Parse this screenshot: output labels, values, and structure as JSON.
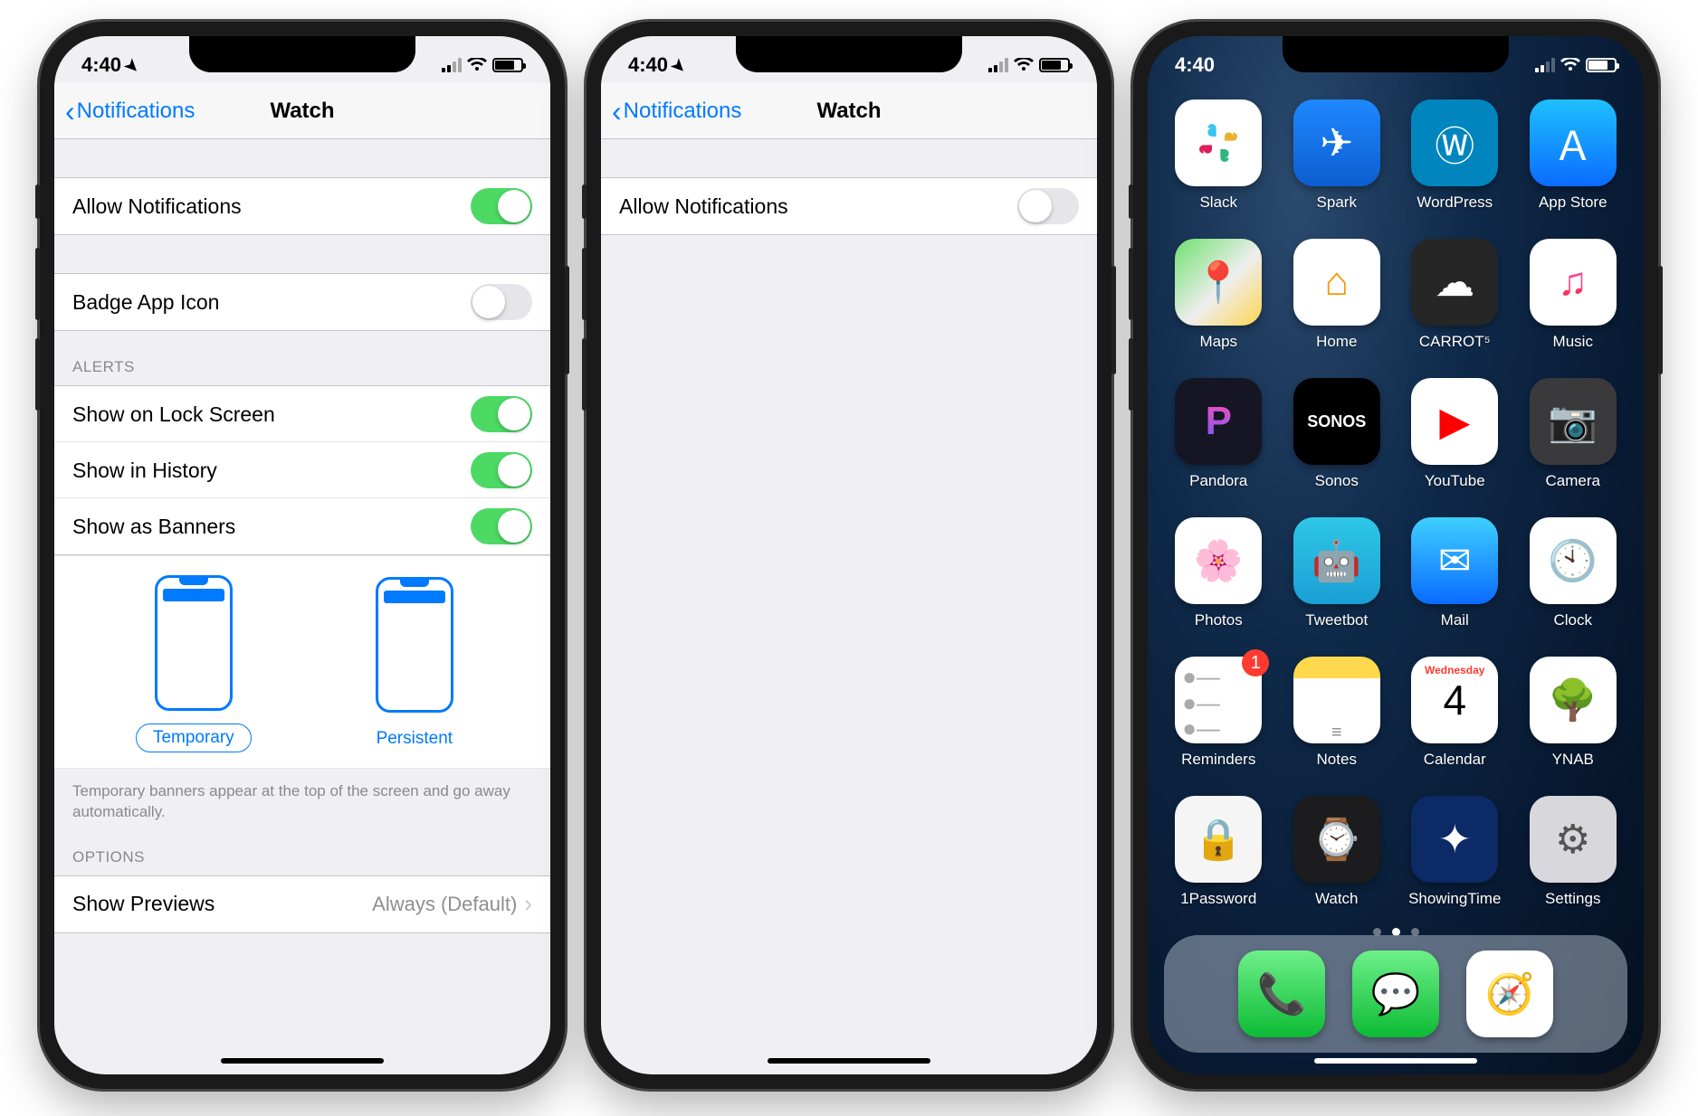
{
  "status": {
    "time": "4:40"
  },
  "screens": {
    "settings_full": {
      "back_label": "Notifications",
      "title": "Watch",
      "allow_label": "Allow Notifications",
      "allow_on": true,
      "badge_label": "Badge App Icon",
      "badge_on": false,
      "alerts_header": "ALERTS",
      "lock_label": "Show on Lock Screen",
      "lock_on": true,
      "history_label": "Show in History",
      "history_on": true,
      "banners_label": "Show as Banners",
      "banners_on": true,
      "banner_temp": "Temporary",
      "banner_pers": "Persistent",
      "banner_footer": "Temporary banners appear at the top of the screen and go away automatically.",
      "options_header": "OPTIONS",
      "previews_label": "Show Previews",
      "previews_value": "Always (Default)"
    },
    "settings_min": {
      "back_label": "Notifications",
      "title": "Watch",
      "allow_label": "Allow Notifications",
      "allow_on": false
    },
    "home": {
      "calendar": {
        "day": "Wednesday",
        "date": "4"
      },
      "reminders_badge": "1",
      "apps": [
        [
          "Slack",
          "Spark",
          "WordPress",
          "App Store"
        ],
        [
          "Maps",
          "Home",
          "CARROT⁵",
          "Music"
        ],
        [
          "Pandora",
          "Sonos",
          "YouTube",
          "Camera"
        ],
        [
          "Photos",
          "Tweetbot",
          "Mail",
          "Clock"
        ],
        [
          "Reminders",
          "Notes",
          "Calendar",
          "YNAB"
        ],
        [
          "1Password",
          "Watch",
          "ShowingTime",
          "Settings"
        ]
      ],
      "dock": [
        "Phone",
        "Messages",
        "Safari"
      ]
    }
  }
}
